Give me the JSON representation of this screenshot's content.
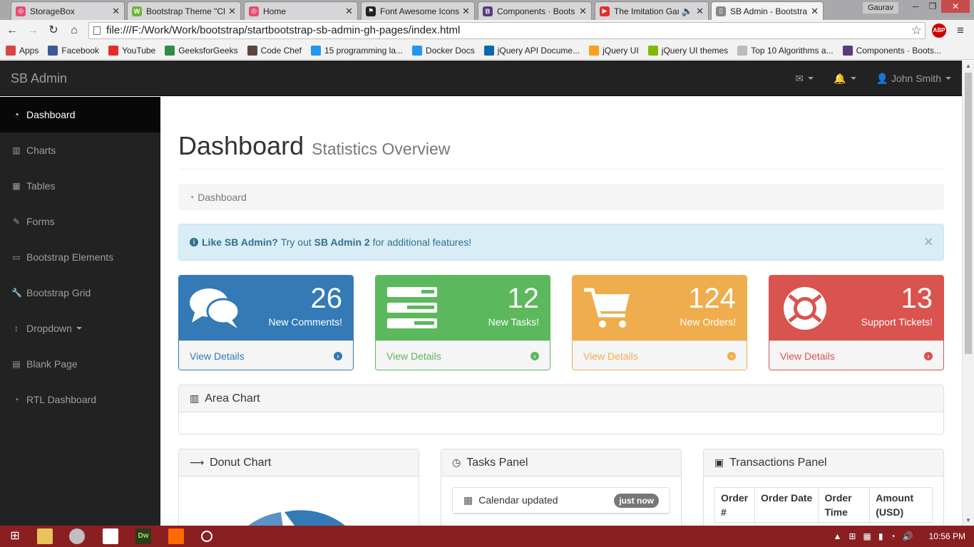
{
  "browser": {
    "tabs": [
      {
        "title": "StorageBox",
        "color": "#e84b6e",
        "glyph": "◎"
      },
      {
        "title": "Bootstrap Theme \"Cl",
        "color": "#6fb33b",
        "glyph": "W"
      },
      {
        "title": "Home",
        "color": "#e84b6e",
        "glyph": "◎"
      },
      {
        "title": "Font Awesome Icons",
        "color": "#222222",
        "glyph": "⚑"
      },
      {
        "title": "Components · Boots",
        "color": "#563d7c",
        "glyph": "B"
      },
      {
        "title": "The Imitation Gan",
        "color": "#e52d27",
        "glyph": "▶"
      },
      {
        "title": "SB Admin - Bootstra",
        "color": "#888888",
        "glyph": "▯"
      }
    ],
    "user": "Gaurav",
    "url": "file:///F:/Work/Work/bootstrap/startbootstrap-sb-admin-gh-pages/index.html",
    "abp": "ABP",
    "bookmarks": [
      {
        "label": "Apps",
        "color": "#d44"
      },
      {
        "label": "Facebook",
        "color": "#3b5998"
      },
      {
        "label": "YouTube",
        "color": "#e52d27"
      },
      {
        "label": "GeeksforGeeks",
        "color": "#2f8d46"
      },
      {
        "label": "Code Chef",
        "color": "#5b4638"
      },
      {
        "label": "15 programming la...",
        "color": "#2196f3"
      },
      {
        "label": "Docker Docs",
        "color": "#2496ed"
      },
      {
        "label": "jQuery API Docume...",
        "color": "#0769ad"
      },
      {
        "label": "jQuery UI",
        "color": "#f7a21b"
      },
      {
        "label": "jQuery UI themes",
        "color": "#7fba00"
      },
      {
        "label": "Top 10 Algorithms a...",
        "color": "#bbbbbb"
      },
      {
        "label": "Components · Boots...",
        "color": "#563d7c"
      }
    ]
  },
  "app": {
    "brand": "SB Admin",
    "user_name": "John Smith",
    "sidebar": [
      {
        "label": "Dashboard",
        "icon": "dashboard-icon",
        "glyph": "◔",
        "active": true
      },
      {
        "label": "Charts",
        "icon": "bar-chart-icon",
        "glyph": "▥"
      },
      {
        "label": "Tables",
        "icon": "table-icon",
        "glyph": "▦"
      },
      {
        "label": "Forms",
        "icon": "edit-icon",
        "glyph": "✎"
      },
      {
        "label": "Bootstrap Elements",
        "icon": "desktop-icon",
        "glyph": "▭"
      },
      {
        "label": "Bootstrap Grid",
        "icon": "wrench-icon",
        "glyph": "🔧"
      },
      {
        "label": "Dropdown",
        "icon": "arrows-v-icon",
        "glyph": "↕",
        "caret": true
      },
      {
        "label": "Blank Page",
        "icon": "file-icon",
        "glyph": "▤"
      },
      {
        "label": "RTL Dashboard",
        "icon": "dashboard-icon",
        "glyph": "◔"
      }
    ],
    "page_title": "Dashboard",
    "page_subtitle": "Statistics Overview",
    "breadcrumb": "Dashboard",
    "alert": {
      "strong1": "Like SB Admin?",
      "text1": "Try out",
      "strong2": "SB Admin 2",
      "text2": "for additional features!"
    },
    "cards": [
      {
        "count": "26",
        "label": "New Comments!",
        "footer": "View Details",
        "color": "#337ab7",
        "border": "#337ab7",
        "foot_color": "#337ab7",
        "icon": "comments-icon"
      },
      {
        "count": "12",
        "label": "New Tasks!",
        "footer": "View Details",
        "color": "#5cb85c",
        "border": "#5cb85c",
        "foot_color": "#5cb85c",
        "icon": "tasks-icon"
      },
      {
        "count": "124",
        "label": "New Orders!",
        "footer": "View Details",
        "color": "#f0ad4e",
        "border": "#f0ad4e",
        "foot_color": "#f0ad4e",
        "icon": "shopping-cart-icon"
      },
      {
        "count": "13",
        "label": "Support Tickets!",
        "footer": "View Details",
        "color": "#d9534f",
        "border": "#d9534f",
        "foot_color": "#d9534f",
        "icon": "support-icon"
      }
    ],
    "area_chart_title": "Area Chart",
    "donut_title": "Donut Chart",
    "tasks_title": "Tasks Panel",
    "tasks": [
      {
        "label": "Calendar updated",
        "badge": "just now"
      }
    ],
    "transactions_title": "Transactions Panel",
    "transaction_columns": [
      "Order #",
      "Order Date",
      "Order Time",
      "Amount (USD)"
    ]
  },
  "taskbar": {
    "time": "10:56 PM"
  }
}
